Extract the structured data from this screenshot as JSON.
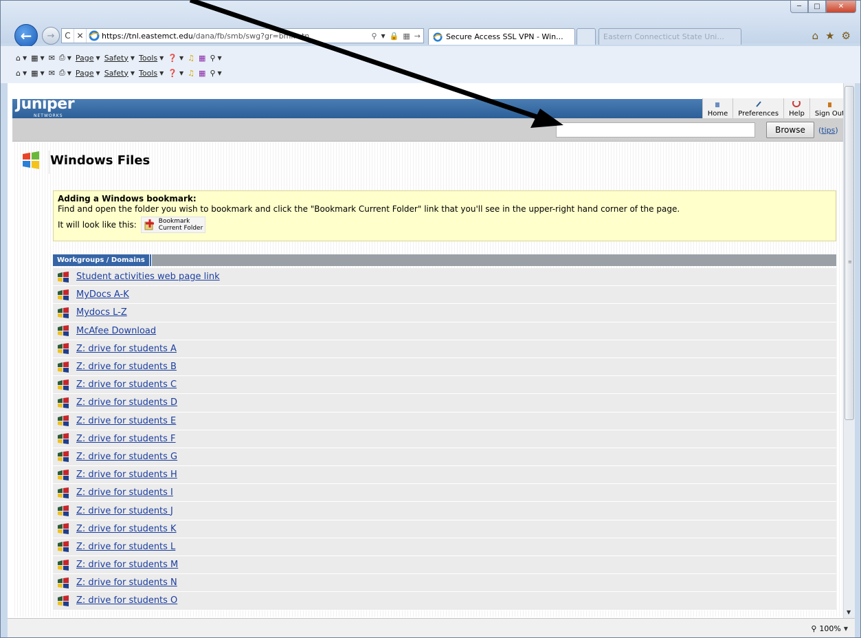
{
  "browser": {
    "url_domain": "https://tnl.eastemct.edu",
    "url_path": "/dana/fb/smb/swg?gr=bmk=tn",
    "tabs": [
      {
        "label": "Secure Access SSL VPN - Win..."
      },
      {
        "label": ""
      },
      {
        "label": "Eastern Connecticut State Uni..."
      }
    ],
    "command_bar": {
      "page_label": "Page",
      "safety_label": "Safety",
      "tools_label": "Tools"
    },
    "zoom_label": "100%"
  },
  "header": {
    "logo_text": "Juniper",
    "logo_sub": "NETWORKS",
    "nav": [
      {
        "label": "Home"
      },
      {
        "label": "Preferences"
      },
      {
        "label": "Help"
      },
      {
        "label": "Sign Out"
      }
    ]
  },
  "browse": {
    "input_value": "",
    "button_label": "Browse",
    "tips_label": "tips"
  },
  "page": {
    "title": "Windows Files"
  },
  "notice": {
    "title": "Adding a Windows bookmark:",
    "body": "Find and open the folder you wish to bookmark and click the \"Bookmark Current Folder\" link that you'll see in the upper-right hand corner of the page.",
    "example_prefix": "It will look like this:",
    "example_line1": "Bookmark",
    "example_line2": "Current Folder"
  },
  "list": {
    "header": "Workgroups / Domains",
    "items": [
      "Student activities web page link",
      "MyDocs A-K",
      "Mydocs L-Z",
      "McAfee Download",
      "Z: drive for students A",
      "Z: drive for students B",
      "Z: drive for students C",
      "Z: drive for students D",
      "Z: drive for students E",
      "Z: drive for students F",
      "Z: drive for students G",
      "Z: drive for students H",
      "Z: drive for students I",
      "Z: drive for students J",
      "Z: drive for students K",
      "Z: drive for students L",
      "Z: drive for students M",
      "Z: drive for students N",
      "Z: drive for students O"
    ]
  },
  "colors": {
    "juniper_blue": "#2c5f97",
    "notice_bg": "#ffffcc",
    "link": "#1b3ea0",
    "arrow": "#000000"
  }
}
